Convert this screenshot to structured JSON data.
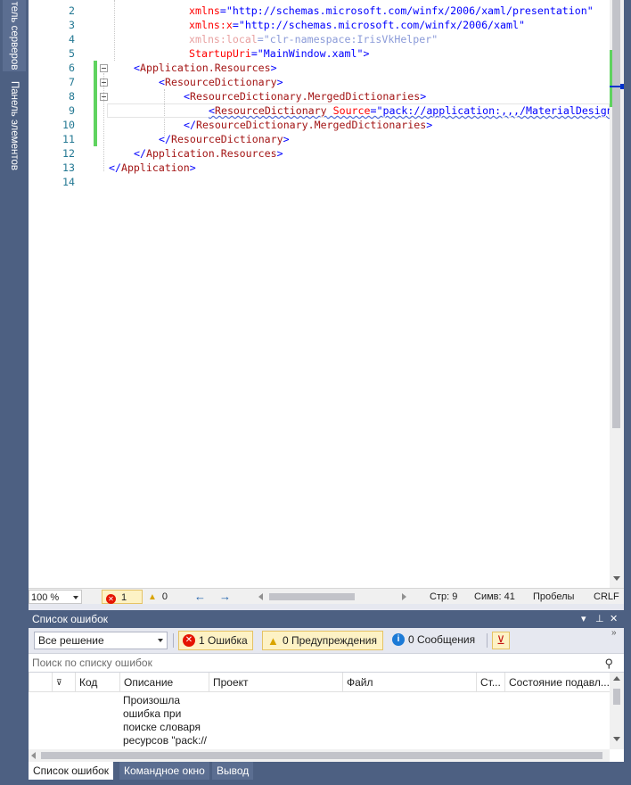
{
  "left_panel_tabs": [
    "тель серверов",
    "Панель элементов"
  ],
  "editor": {
    "lines": [
      {
        "num": "2",
        "parts": [
          {
            "t": "xmlns",
            "c": "attr"
          },
          {
            "t": "=",
            "c": "bracket"
          },
          {
            "t": "\"http://schemas.microsoft.com/winfx/2006/xaml/presentation\"",
            "c": "val"
          }
        ]
      },
      {
        "num": "3",
        "parts": [
          {
            "t": "xmlns:x",
            "c": "attr"
          },
          {
            "t": "=",
            "c": "bracket"
          },
          {
            "t": "\"http://schemas.microsoft.com/winfx/2006/xaml\"",
            "c": "val"
          }
        ]
      },
      {
        "num": "4",
        "parts": [
          {
            "t": "xmlns:local",
            "c": "attr-faded"
          },
          {
            "t": "=",
            "c": "val-faded"
          },
          {
            "t": "\"clr-namespace:IrisVkHelper\"",
            "c": "val-faded"
          }
        ]
      },
      {
        "num": "5",
        "parts": [
          {
            "t": "StartupUri",
            "c": "attr"
          },
          {
            "t": "=",
            "c": "bracket"
          },
          {
            "t": "\"MainWindow.xaml\"",
            "c": "val"
          },
          {
            "t": ">",
            "c": "bracket"
          }
        ]
      },
      {
        "num": "6",
        "parts": [
          {
            "t": "<",
            "c": "bracket"
          },
          {
            "t": "Application.Resources",
            "c": "tag"
          },
          {
            "t": ">",
            "c": "bracket"
          }
        ]
      },
      {
        "num": "7",
        "parts": [
          {
            "t": "<",
            "c": "bracket"
          },
          {
            "t": "ResourceDictionary",
            "c": "tag"
          },
          {
            "t": ">",
            "c": "bracket"
          }
        ]
      },
      {
        "num": "8",
        "parts": [
          {
            "t": "<",
            "c": "bracket"
          },
          {
            "t": "ResourceDictionary.MergedDictionaries",
            "c": "tag"
          },
          {
            "t": ">",
            "c": "bracket"
          }
        ]
      },
      {
        "num": "9",
        "parts": [
          {
            "t": "<",
            "c": "bracket"
          },
          {
            "t": "ResourceDictionary",
            "c": "tag"
          },
          {
            "t": " ",
            "c": "tag"
          },
          {
            "t": "Source",
            "c": "attr"
          },
          {
            "t": "=",
            "c": "bracket"
          },
          {
            "t": "\"pack://application:,,,/MaterialDesignThemes.Wpf;component/Themes/MaterialDesignTheme.Light.xaml\"",
            "c": "val"
          }
        ]
      },
      {
        "num": "10",
        "parts": [
          {
            "t": "</",
            "c": "bracket"
          },
          {
            "t": "ResourceDictionary.MergedDictionaries",
            "c": "tag"
          },
          {
            "t": ">",
            "c": "bracket"
          }
        ]
      },
      {
        "num": "11",
        "parts": [
          {
            "t": "</",
            "c": "bracket"
          },
          {
            "t": "ResourceDictionary",
            "c": "tag"
          },
          {
            "t": ">",
            "c": "bracket"
          }
        ]
      },
      {
        "num": "12",
        "parts": [
          {
            "t": "</",
            "c": "bracket"
          },
          {
            "t": "Application.Resources",
            "c": "tag"
          },
          {
            "t": ">",
            "c": "bracket"
          }
        ]
      },
      {
        "num": "13",
        "parts": [
          {
            "t": "</",
            "c": "bracket"
          },
          {
            "t": "Application",
            "c": "tag"
          },
          {
            "t": ">",
            "c": "bracket"
          }
        ]
      },
      {
        "num": "14",
        "parts": []
      }
    ]
  },
  "status": {
    "zoom": "100 %",
    "errors": "1",
    "warnings": "0",
    "line": "Стр: 9",
    "col": "Симв: 41",
    "whitespace": "Пробелы",
    "eol": "CRLF"
  },
  "error_list": {
    "title": "Список ошибок",
    "scope": "Все решение",
    "errors_btn": "1 Ошибка",
    "warnings_btn": "0 Предупреждения",
    "messages_btn": "0 Сообщения",
    "search_placeholder": "Поиск по списку ошибок",
    "columns": [
      "Код",
      "Описание",
      "Проект",
      "Файл",
      "Ст...",
      "Состояние подавл..."
    ],
    "rows": [
      {
        "description": "Произошла ошибка при поиске словаря ресурсов \"pack://"
      }
    ]
  },
  "bottom_tabs": [
    "Список ошибок",
    "Командное окно",
    "Вывод"
  ],
  "colors": {
    "accent": "#4d6082",
    "error": "#e51400",
    "warning": "#f2c200",
    "info": "#1c7ad6",
    "change_bar": "#5fd35f"
  }
}
